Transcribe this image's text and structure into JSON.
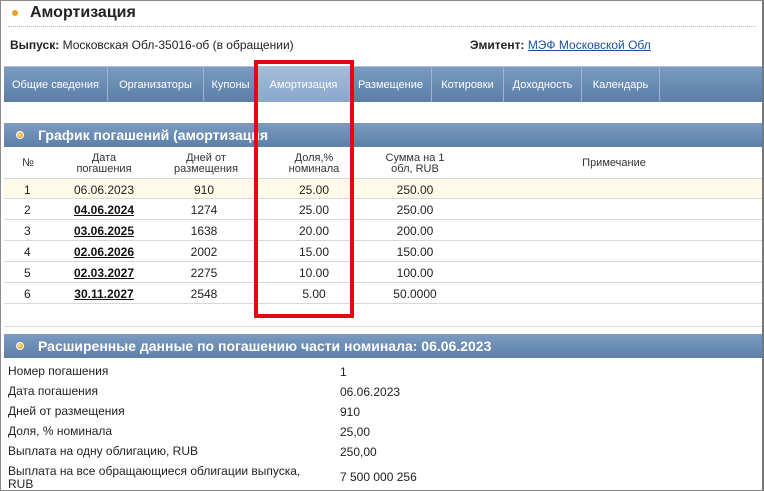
{
  "page": {
    "title": "Амортизация",
    "issue_label": "Выпуск:",
    "issue_value": "Московская Обл-35016-об (в обращении)",
    "issuer_label": "Эмитент:",
    "issuer_value": "МЭФ Московской Обл"
  },
  "tabs": [
    {
      "label": "Общие сведения"
    },
    {
      "label": "Организаторы"
    },
    {
      "label": "Купоны"
    },
    {
      "label": "Амортизация"
    },
    {
      "label": "Размещение"
    },
    {
      "label": "Котировки"
    },
    {
      "label": "Доходность"
    },
    {
      "label": "Календарь"
    }
  ],
  "schedule": {
    "title": "График погашений (амортизация",
    "headers": {
      "num": "№",
      "date": "Дата погашения",
      "days": "Дней от размещения",
      "share": "Доля,% номинала",
      "sum": "Сумма на 1 обл, RUB",
      "note": "Примечание"
    },
    "rows": [
      {
        "num": "1",
        "date": "06.06.2023",
        "days": "910",
        "share": "25.00",
        "sum": "250.00"
      },
      {
        "num": "2",
        "date": "04.06.2024",
        "days": "1274",
        "share": "25.00",
        "sum": "250.00"
      },
      {
        "num": "3",
        "date": "03.06.2025",
        "days": "1638",
        "share": "20.00",
        "sum": "200.00"
      },
      {
        "num": "4",
        "date": "02.06.2026",
        "days": "2002",
        "share": "15.00",
        "sum": "150.00"
      },
      {
        "num": "5",
        "date": "02.03.2027",
        "days": "2275",
        "share": "10.00",
        "sum": "100.00"
      },
      {
        "num": "6",
        "date": "30.11.2027",
        "days": "2548",
        "share": "5.00",
        "sum": "50.0000"
      }
    ]
  },
  "details": {
    "title": "Расширенные данные по погашению части номинала: 06.06.2023",
    "rows": [
      {
        "label": "Номер погашения",
        "value": "1"
      },
      {
        "label": "Дата погашения",
        "value": "06.06.2023"
      },
      {
        "label": "Дней от размещения",
        "value": "910"
      },
      {
        "label": "Доля, % номинала",
        "value": "25,00"
      },
      {
        "label": "Выплата на одну облигацию, RUB",
        "value": "250,00"
      },
      {
        "label": "Выплата на все обращающиеся облигации выпуска, RUB",
        "value": "7 500 000 256"
      }
    ]
  },
  "colors": {
    "tab_bar": "#5b7ea7",
    "active_tab": "#8aa7cc",
    "highlight_box": "#e30613",
    "link": "#1b4f9b"
  }
}
